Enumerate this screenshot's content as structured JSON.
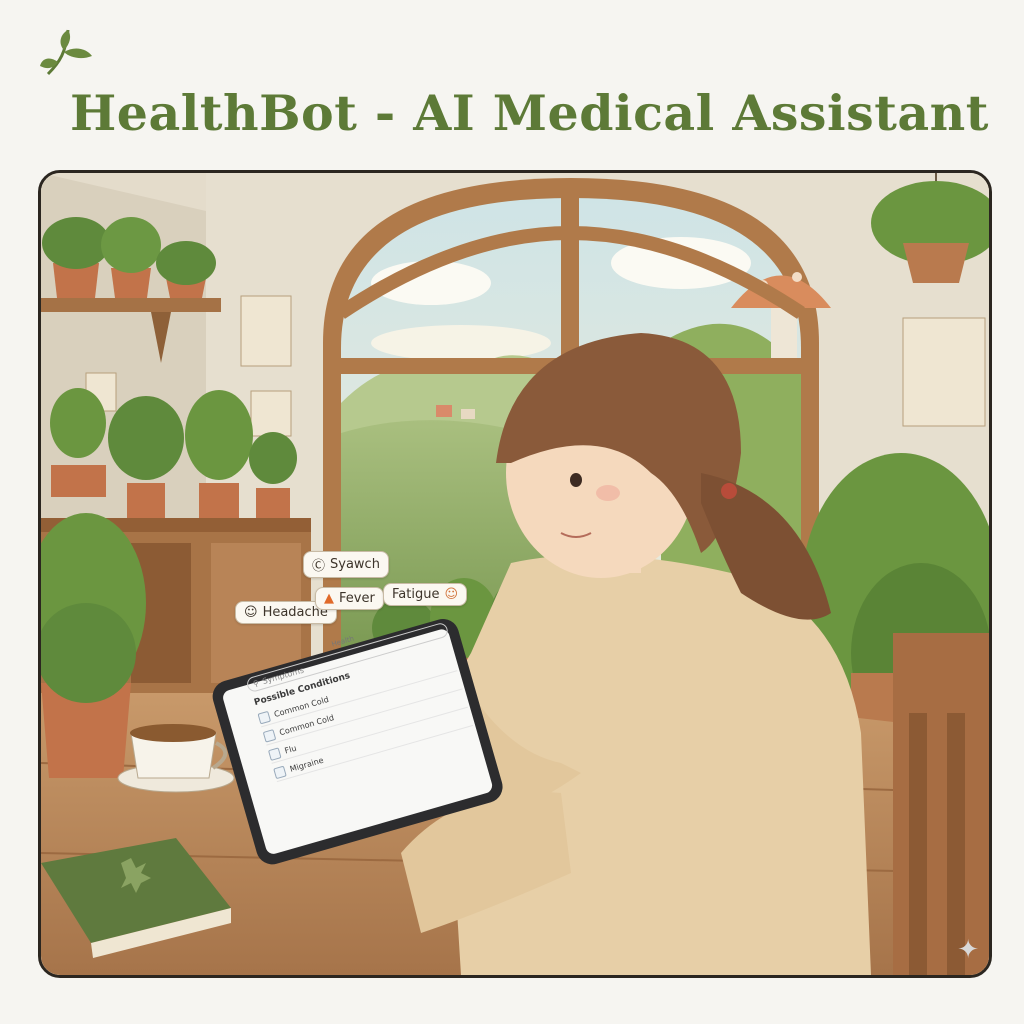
{
  "header": {
    "title": "HealthBot - AI Medical Assistant",
    "logo_icon": "leaf-sprig-icon"
  },
  "illustration": {
    "symptom_bubbles": [
      {
        "label": "Syawch",
        "icon": "s-circle-icon"
      },
      {
        "label": "Headache",
        "icon": "face-icon"
      },
      {
        "label": "Fever",
        "icon": "flame-icon"
      },
      {
        "label": "Fatigue",
        "icon": "face-icon"
      }
    ],
    "tablet": {
      "status_text": "Health",
      "search_placeholder": "Symptoms",
      "app_label": "Hd",
      "section_title": "Possible Conditions",
      "conditions": [
        "Common Cold",
        "Common Cold",
        "Flu",
        "Migraine"
      ]
    }
  },
  "colors": {
    "accent": "#5d7a37",
    "frame": "#2b2620",
    "background": "#f6f5f1"
  }
}
